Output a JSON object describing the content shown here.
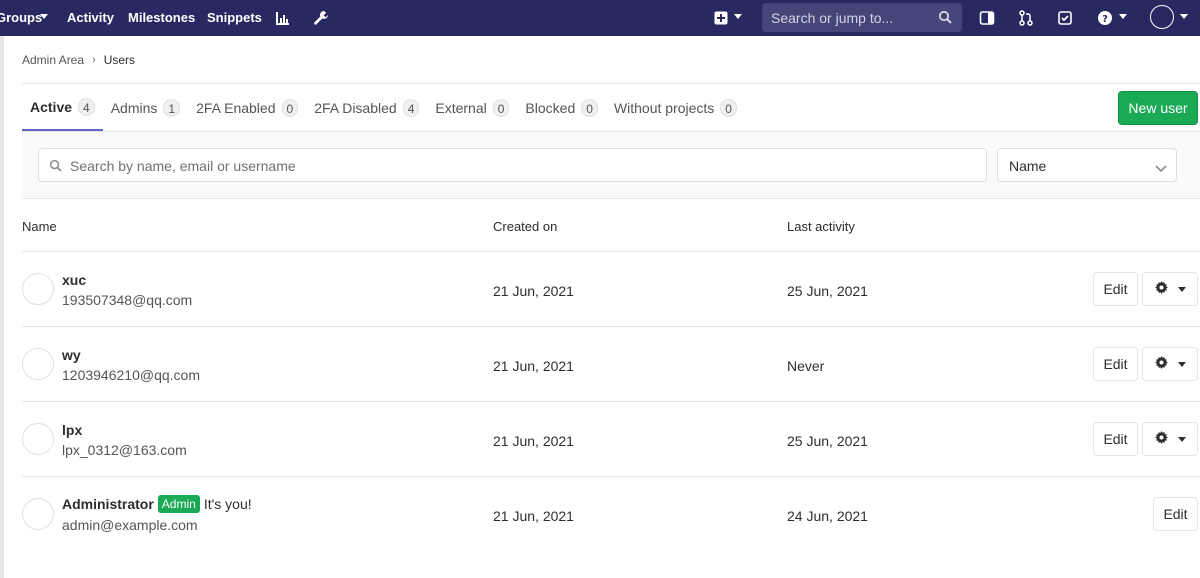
{
  "navbar": {
    "links": [
      "Groups",
      "Activity",
      "Milestones",
      "Snippets"
    ],
    "search_placeholder": "Search or jump to...",
    "icons": [
      "chart-icon",
      "wrench-icon",
      "plus-square-icon",
      "sidebar-toggle-icon",
      "merge-request-icon",
      "todo-check-icon",
      "help-icon",
      "user-avatar-icon"
    ]
  },
  "breadcrumb": {
    "parent": "Admin Area",
    "current": "Users"
  },
  "tabs": [
    {
      "label": "Active",
      "count": "4"
    },
    {
      "label": "Admins",
      "count": "1"
    },
    {
      "label": "2FA Enabled",
      "count": "0"
    },
    {
      "label": "2FA Disabled",
      "count": "4"
    },
    {
      "label": "External",
      "count": "0"
    },
    {
      "label": "Blocked",
      "count": "0"
    },
    {
      "label": "Without projects",
      "count": "0"
    }
  ],
  "new_user_label": "New user",
  "filter": {
    "search_placeholder": "Search by name, email or username",
    "sort_value": "Name"
  },
  "table": {
    "headers": {
      "name": "Name",
      "created": "Created on",
      "last_activity": "Last activity"
    },
    "rows": [
      {
        "name": "xuc",
        "email": "193507348@qq.com",
        "created": "21 Jun, 2021",
        "last_activity": "25 Jun, 2021",
        "edit_label": "Edit"
      },
      {
        "name": "wy",
        "email": "1203946210@qq.com",
        "created": "21 Jun, 2021",
        "last_activity": "Never",
        "edit_label": "Edit"
      },
      {
        "name": "lpx",
        "email": "lpx_0312@163.com",
        "created": "21 Jun, 2021",
        "last_activity": "25 Jun, 2021",
        "edit_label": "Edit"
      },
      {
        "name": "Administrator",
        "badge": "Admin",
        "note": "It's you!",
        "email": "admin@example.com",
        "created": "21 Jun, 2021",
        "last_activity": "24 Jun, 2021",
        "edit_label": "Edit"
      }
    ]
  },
  "colors": {
    "navbar": "#292961",
    "accent_green": "#1aaa55",
    "tab_active": "#6666c4"
  }
}
